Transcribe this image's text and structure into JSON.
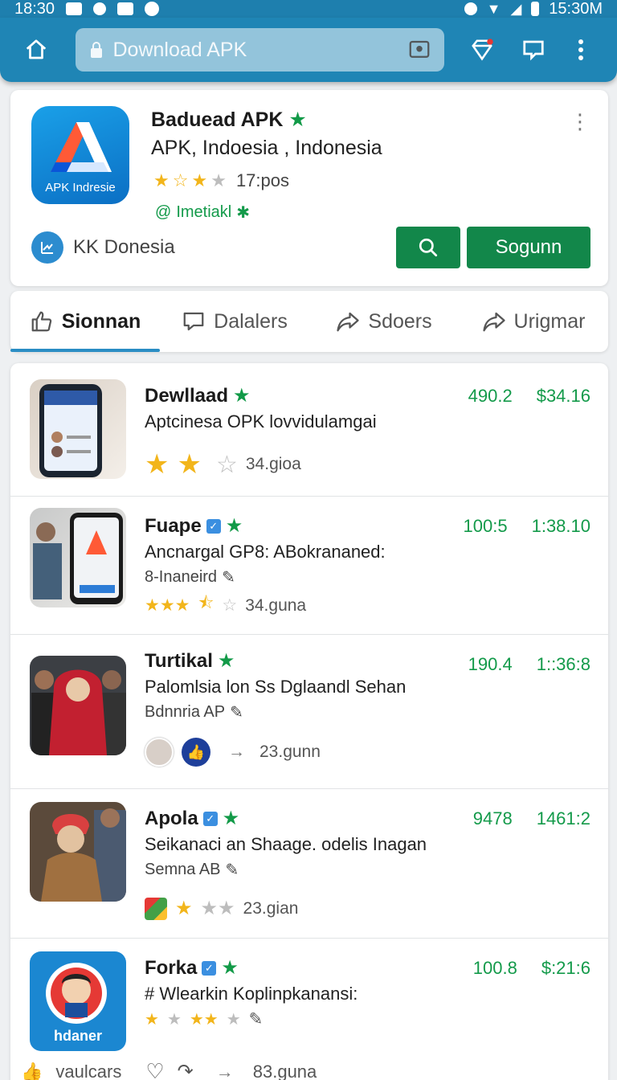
{
  "status_bar": {
    "time_left": "18:30",
    "time_right": "15:30M"
  },
  "toolbar": {
    "url_text": "Download APK"
  },
  "header": {
    "title": "Baduead APK",
    "subtitle": "APK, Indoesia , Indonesia",
    "rating_stars": 3,
    "rating_count": "17:pos",
    "tag": "Imetiakl",
    "icon_caption": "APK Indresie",
    "developer": "KK Donesia",
    "action_button": "Sogunn"
  },
  "tabs": [
    {
      "label": "Sionnan",
      "icon": "thumbs-up-icon",
      "active": true
    },
    {
      "label": "Dalalers",
      "icon": "chat-icon",
      "active": false
    },
    {
      "label": "Sdoers",
      "icon": "share-icon",
      "active": false
    },
    {
      "label": "Urigmar",
      "icon": "share-icon",
      "active": false
    }
  ],
  "apps": [
    {
      "title": "Dewllaad",
      "desc": "Aptcinesa OPK lovvidulamgai",
      "meta": "",
      "stat1": "490.2",
      "stat2": "$34.16",
      "stars": 2,
      "count": "34.gioa"
    },
    {
      "title": "Fuape",
      "desc": "Ancnargal GP8: ABokrananed:",
      "meta": "8-Inaneird",
      "stat1": "100:5",
      "stat2": "1:38.10",
      "stars": 4,
      "count": "34.guna"
    },
    {
      "title": "Turtikal",
      "desc": "Palomlsia lon Ss Dglaandl Sehan",
      "meta": "Bdnnria AP",
      "stat1": "190.4",
      "stat2": "1::36:8",
      "stars": 0,
      "count": "23.gunn"
    },
    {
      "title": "Apola",
      "desc": "Seikanaci an Shaage. odelis Inagan",
      "meta": "Semna AB",
      "stat1": "9478",
      "stat2": "1461:2",
      "stars": 1,
      "count": "23.gian"
    },
    {
      "title": "Forka",
      "desc": "# Wlearkin Koplinpkanansi:",
      "meta": "",
      "stat1": "100.8",
      "stat2": "$:21:6",
      "stars": 3,
      "count": ""
    }
  ],
  "forka_icon_caption": "hdaner",
  "footer": {
    "label": "vaulcars",
    "count": "83.guna"
  },
  "colors": {
    "toolbar": "#1f85b5",
    "accent_green": "#12874a",
    "stat_green": "#139a4a"
  }
}
